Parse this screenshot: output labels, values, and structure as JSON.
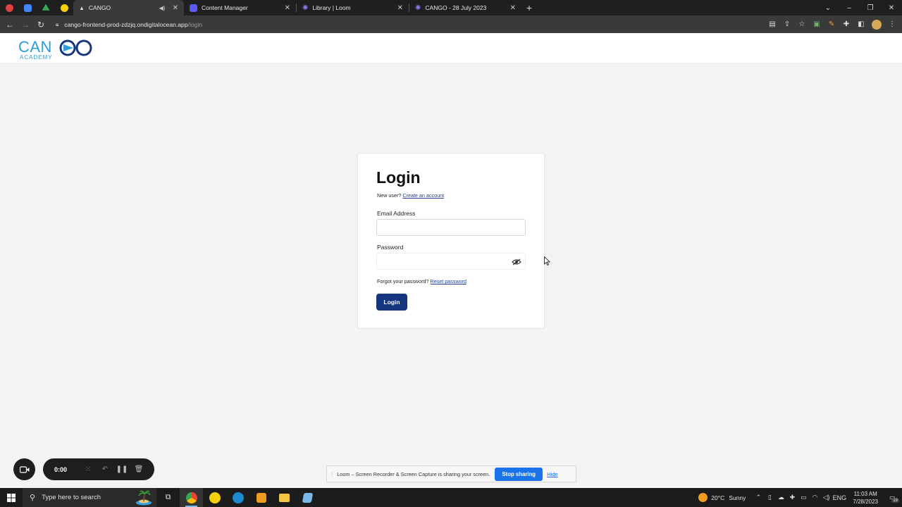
{
  "browser": {
    "tabs": [
      {
        "title": "CANGO",
        "active": true,
        "icon": "cango-favicon",
        "audio": true
      },
      {
        "title": "Content Manager",
        "active": false,
        "icon": "content-manager-favicon"
      },
      {
        "title": "Library | Loom",
        "active": false,
        "icon": "loom-favicon"
      },
      {
        "title": "CANGO - 28 July 2023",
        "active": false,
        "icon": "loom-favicon"
      }
    ],
    "address": {
      "host": "cango-frontend-prod-zdzjq.ondigitalocean.app",
      "path": "/login"
    }
  },
  "login": {
    "heading": "Login",
    "new_user_text": "New user?",
    "create_account_link": "Create an account",
    "email_label": "Email Address",
    "email_value": "",
    "password_label": "Password",
    "password_value": "",
    "forgot_text": "Forgot your password?",
    "reset_link": "Reset password",
    "submit_label": "Login"
  },
  "loom": {
    "timer": "0:00",
    "share_text": "Loom – Screen Recorder & Screen Capture is sharing your screen.",
    "stop_label": "Stop sharing",
    "hide_label": "Hide"
  },
  "taskbar": {
    "search_placeholder": "Type here to search",
    "weather_temp": "20°C",
    "weather_desc": "Sunny",
    "language": "ENG",
    "time": "11:03 AM",
    "date": "7/28/2023",
    "notification_count": "19"
  },
  "colors": {
    "brand_blue": "#16357f",
    "logo_cyan": "#2f9ed8",
    "accent_blue": "#1a73e8"
  }
}
